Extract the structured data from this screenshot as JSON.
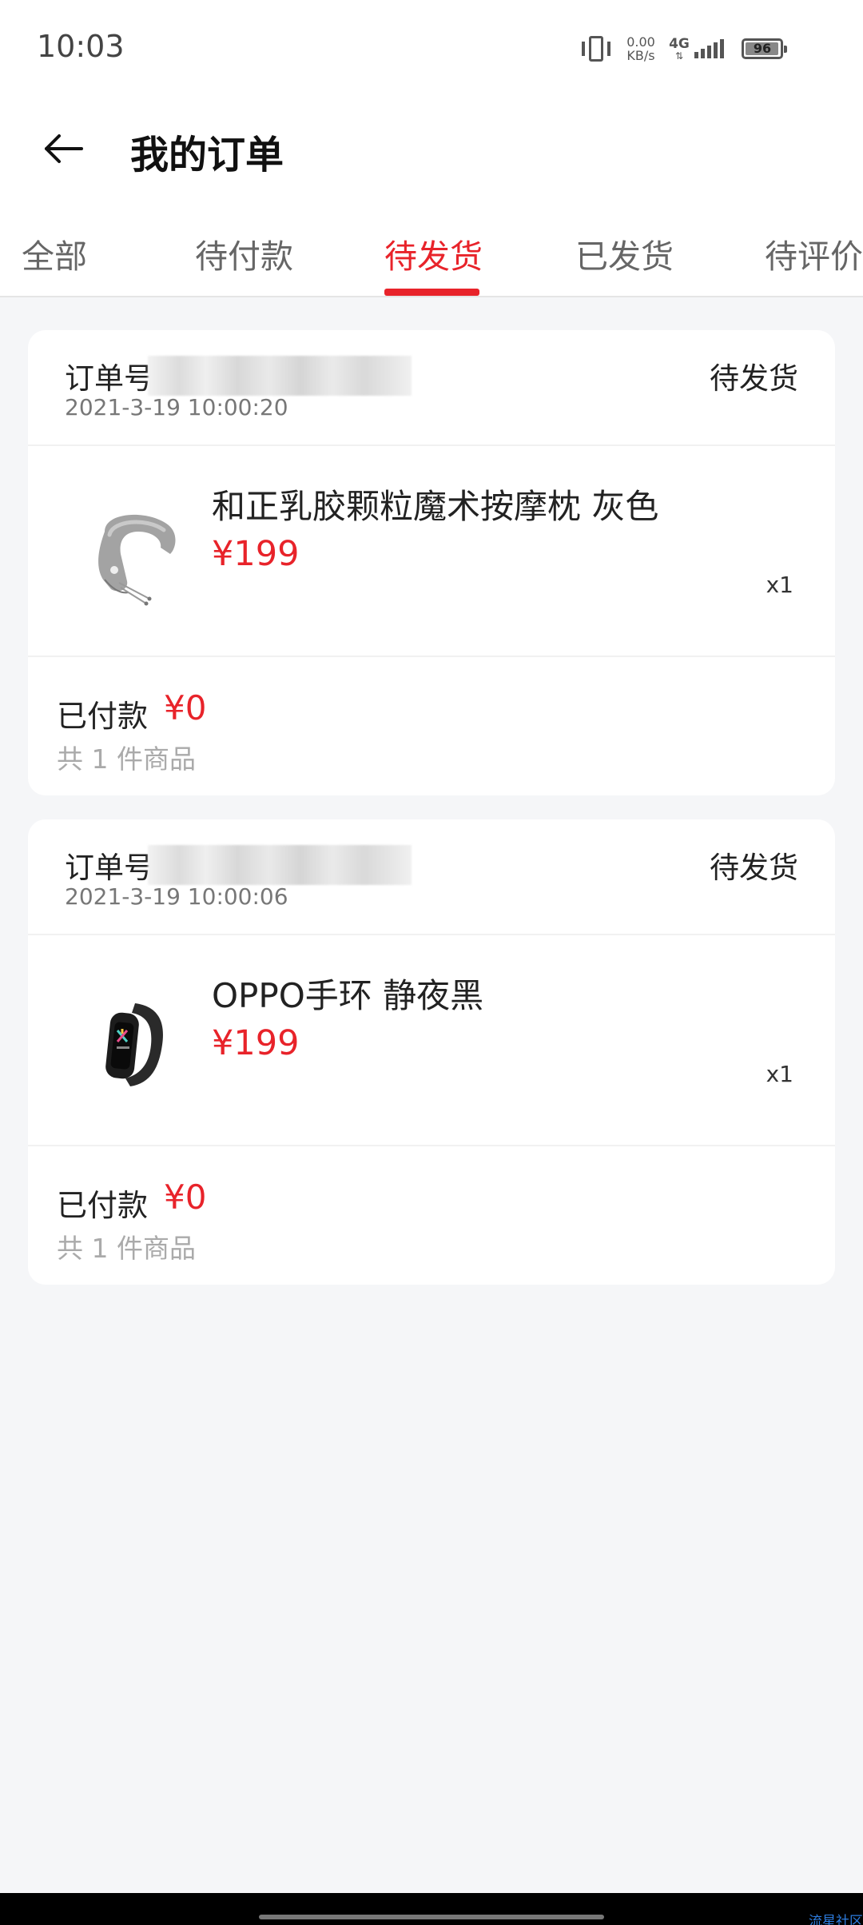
{
  "status_bar": {
    "time": "10:03",
    "speed_value": "0.00",
    "speed_unit": "KB/s",
    "network": "4G",
    "battery": "96",
    "battery_level": 0.96
  },
  "header": {
    "title": "我的订单",
    "back_icon": "arrow-left-icon"
  },
  "tabs": [
    {
      "label": "全部",
      "active": false
    },
    {
      "label": "待付款",
      "active": false
    },
    {
      "label": "待发货",
      "active": true
    },
    {
      "label": "已发货",
      "active": false
    },
    {
      "label": "待评价",
      "active": false
    }
  ],
  "orders": [
    {
      "order_label": "订单号",
      "status": "待发货",
      "time": "2021-3-19 10:00:20",
      "product": {
        "name": "和正乳胶颗粒魔术按摩枕 灰色",
        "price": "¥199",
        "qty": "x1",
        "image_icon": "neck-pillow-image"
      },
      "paid_label": "已付款",
      "paid_amount": "¥0",
      "count_text": "共 1 件商品"
    },
    {
      "order_label": "订单号",
      "status": "待发货",
      "time": "2021-3-19 10:00:06",
      "product": {
        "name": "OPPO手环 静夜黑",
        "price": "¥199",
        "qty": "x1",
        "image_icon": "smart-band-image"
      },
      "paid_label": "已付款",
      "paid_amount": "¥0",
      "count_text": "共 1 件商品"
    }
  ],
  "watermark": "流星社区",
  "colors": {
    "accent": "#e8232a",
    "background": "#f5f6f8",
    "card": "#ffffff"
  }
}
